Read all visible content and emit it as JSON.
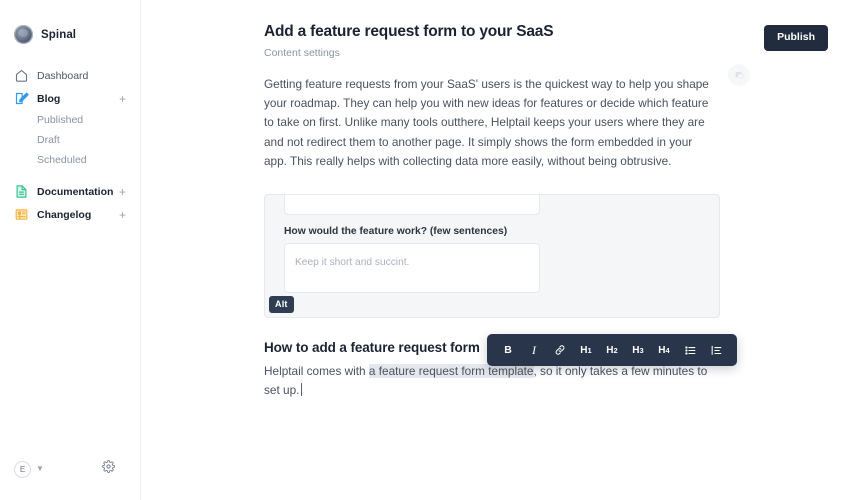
{
  "sidebar": {
    "brand": {
      "name": "Spinal",
      "logo_icon": "spiral-logo-icon"
    },
    "items": [
      {
        "label": "Dashboard",
        "icon": "home-icon",
        "bold": false,
        "plus": ""
      },
      {
        "label": "Blog",
        "icon": "pencil-square-icon",
        "bold": true,
        "plus": "+"
      },
      {
        "label": "Documentation",
        "icon": "document-icon",
        "bold": true,
        "plus": "+"
      },
      {
        "label": "Changelog",
        "icon": "newspaper-icon",
        "bold": true,
        "plus": "+"
      }
    ],
    "blog_children": [
      "Published",
      "Draft",
      "Scheduled"
    ],
    "footer": {
      "avatar_initial": "E",
      "chevron_icon": "chevron-down-icon",
      "settings_icon": "gear-icon"
    },
    "colors": {
      "blog_icon": "#2f9bf0",
      "documentation_icon": "#34c38f",
      "changelog_icon": "#f5b544"
    }
  },
  "header": {
    "title": "Add a feature request form to your SaaS",
    "subtitle": "Content settings",
    "publish_label": "Publish",
    "comment_icon": "comment-bubble-icon"
  },
  "document": {
    "paragraph": "Getting feature requests from your SaaS' users is the quickest way to help you shape your roadmap. They can help you with new ideas for features or decide which feature to take on first. Unlike many tools outthere, Helptail keeps your users where they are and not redirect them to another page. It simply shows the form embedded in your app. This really helps with collecting data more easily, without being obtrusive.",
    "heading2": "How to add a feature request form",
    "paragraph2_pre": "Helptail comes with ",
    "paragraph2_selected": "a feature request form template",
    "paragraph2_post": ", so it only takes a few minutes to set up.",
    "embed": {
      "alt_badge": "Alt",
      "field_label": "How would the feature work? (few sentences)",
      "field_placeholder": "Keep it short and succint."
    }
  },
  "toolbar": {
    "buttons": [
      {
        "label": "B",
        "name": "bold-button",
        "type": "b"
      },
      {
        "label": "I",
        "name": "italic-button",
        "type": "i"
      },
      {
        "label": "",
        "name": "link-icon",
        "type": "link"
      },
      {
        "label": "H",
        "sup": "1",
        "name": "heading-1-button",
        "type": "h"
      },
      {
        "label": "H",
        "sup": "2",
        "name": "heading-2-button",
        "type": "h"
      },
      {
        "label": "H",
        "sup": "3",
        "name": "heading-3-button",
        "type": "h"
      },
      {
        "label": "H",
        "sup": "4",
        "name": "heading-4-button",
        "type": "h"
      },
      {
        "label": "",
        "name": "bullet-list-icon",
        "type": "ul"
      },
      {
        "label": "",
        "name": "ordered-list-icon",
        "type": "ol"
      }
    ],
    "background": "#29354a"
  }
}
